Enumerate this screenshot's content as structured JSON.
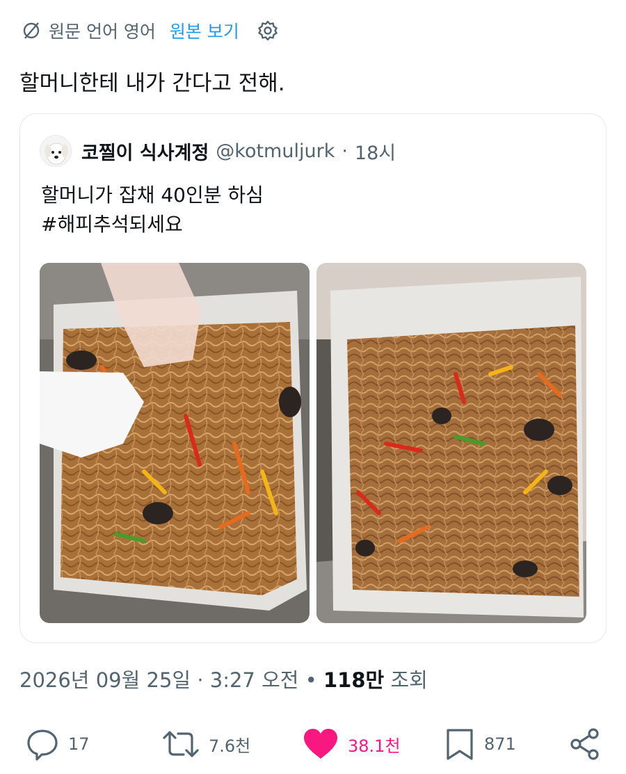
{
  "translation": {
    "source_label": "원문 언어 영어",
    "show_original": "원본 보기",
    "globe_icon": "translate-icon",
    "settings_icon": "gear-icon"
  },
  "tweet": {
    "text": "할머니한테 내가 간다고 전해."
  },
  "quote": {
    "name": "코찔이 식사계정",
    "handle": "@kotmuljurk",
    "separator": "·",
    "time": "18시",
    "lines": [
      "할머니가 잡채 40인분 하심",
      "#해피추석되세요"
    ]
  },
  "meta": {
    "date": "2026년 09월 25일",
    "sep1": "·",
    "time": "3:27 오전",
    "sep2": "•",
    "views_count": "118만",
    "views_label": "조회"
  },
  "actions": {
    "reply_count": "17",
    "retweet_count": "7.6천",
    "like_count": "38.1천",
    "bookmark_count": "871"
  },
  "colors": {
    "accent": "#1d9bf0",
    "like": "#f91880",
    "muted": "#536471",
    "text": "#0f1419"
  }
}
